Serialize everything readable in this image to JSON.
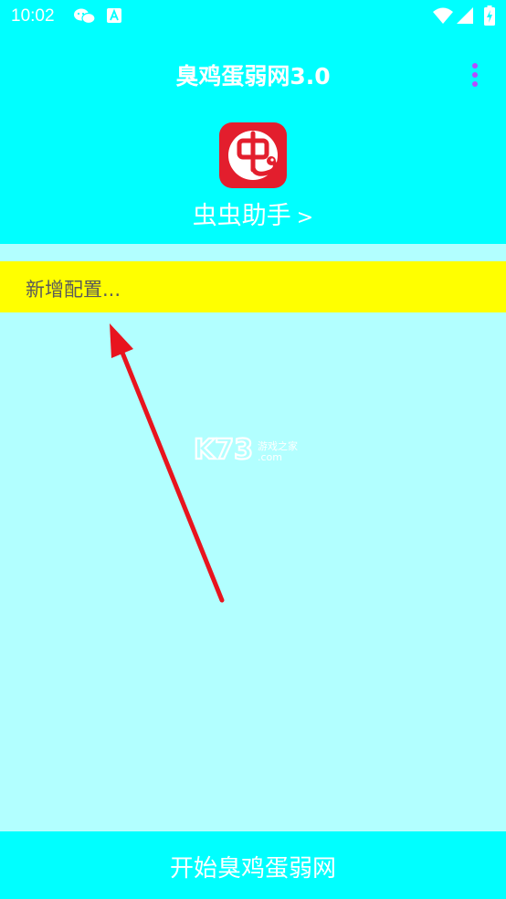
{
  "status_bar": {
    "time": "10:02",
    "icons": [
      "wechat-icon",
      "a-icon",
      "wifi-icon",
      "signal-icon",
      "battery-icon"
    ]
  },
  "header": {
    "title": "臭鸡蛋弱网3.0",
    "menu_icon": "more-vert-icon",
    "logo_icon": "chongchong-logo-icon",
    "assistant_link": "虫虫助手",
    "assistant_chevron": ">"
  },
  "config": {
    "new_config_label": "新增配置..."
  },
  "watermark": {
    "brand": "K73",
    "subtitle": "游戏之家",
    "domain": ".com"
  },
  "footer": {
    "start_button": "开始臭鸡蛋弱网"
  },
  "colors": {
    "header_bg": "#00FFFF",
    "body_bg": "#B2FFFF",
    "highlight_row": "#FFFF00",
    "menu_dots": "#B44CFF",
    "logo_red": "#E31E2D",
    "arrow": "#E8141E"
  }
}
